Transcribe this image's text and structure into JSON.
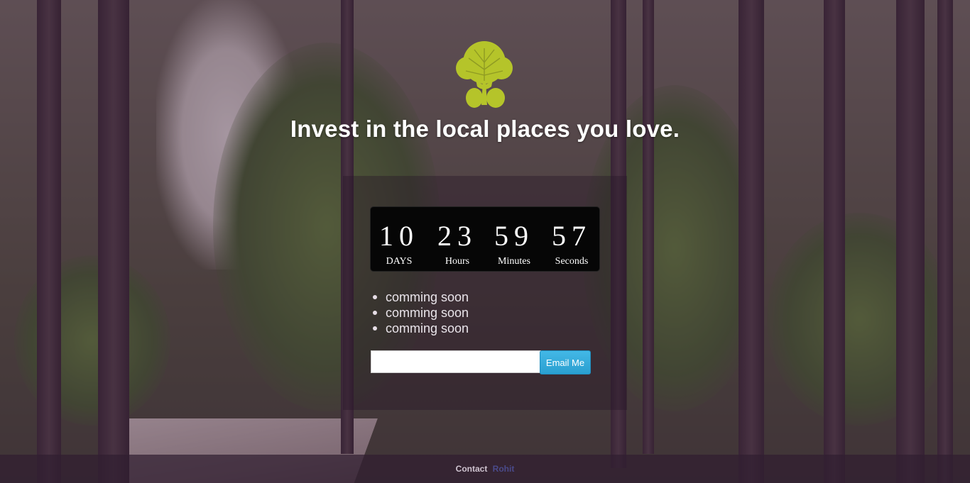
{
  "logo": {
    "icon": "tree-icon",
    "color": "#b5c42a"
  },
  "headline": "Invest in the local places you love.",
  "countdown": {
    "days": {
      "value": "10",
      "label": "DAYS"
    },
    "hours": {
      "value": "23",
      "label": "Hours"
    },
    "minutes": {
      "value": "59",
      "label": "Minutes"
    },
    "seconds": {
      "value": "57",
      "label": "Seconds"
    }
  },
  "features": [
    "comming soon",
    "comming soon",
    "comming soon"
  ],
  "subscribe": {
    "input_value": "",
    "button_label": "Email Me"
  },
  "footer": {
    "contact_label": "Contact",
    "contact_link": "Rohit"
  }
}
